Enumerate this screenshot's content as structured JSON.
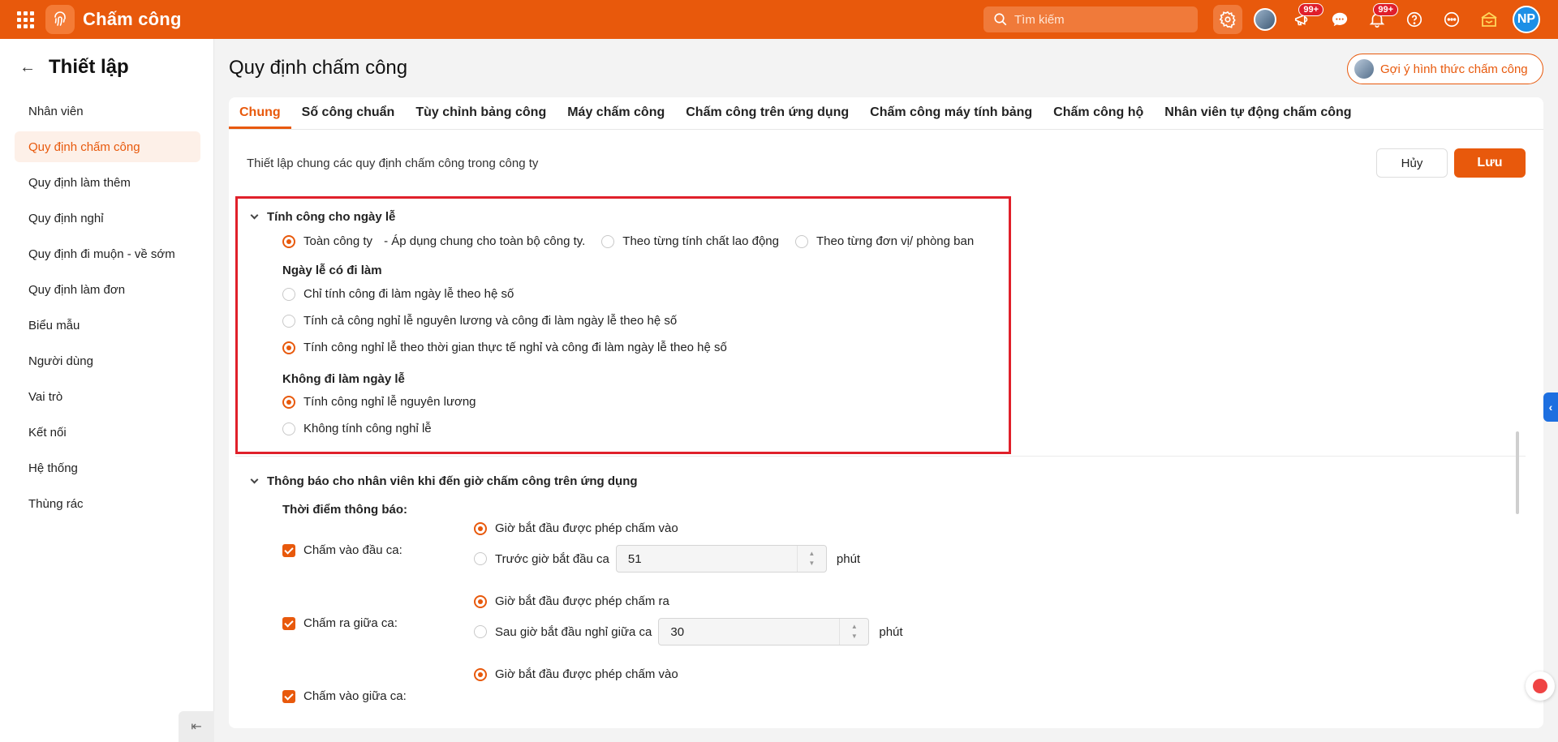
{
  "app": {
    "title": "Chấm công"
  },
  "search": {
    "placeholder": "Tìm kiếm"
  },
  "topbar": {
    "badge_1": "99+",
    "badge_2": "99+",
    "user_initials": "NP",
    "icons": [
      "apps-grid-icon",
      "fingerprint-icon",
      "settings-icon",
      "avatar",
      "megaphone-icon",
      "chat-icon",
      "bell-icon",
      "help-icon",
      "more-icon",
      "gift-icon"
    ]
  },
  "sidebar": {
    "title": "Thiết lập",
    "items": [
      {
        "label": "Nhân viên",
        "active": false
      },
      {
        "label": "Quy định chấm công",
        "active": true
      },
      {
        "label": "Quy định làm thêm",
        "active": false
      },
      {
        "label": "Quy định nghỉ",
        "active": false
      },
      {
        "label": "Quy định đi muộn - về sớm",
        "active": false
      },
      {
        "label": "Quy định làm đơn",
        "active": false
      },
      {
        "label": "Biểu mẫu",
        "active": false
      },
      {
        "label": "Người dùng",
        "active": false
      },
      {
        "label": "Vai trò",
        "active": false
      },
      {
        "label": "Kết nối",
        "active": false
      },
      {
        "label": "Hệ thống",
        "active": false
      },
      {
        "label": "Thùng rác",
        "active": false
      }
    ]
  },
  "main": {
    "page_title": "Quy định chấm công",
    "suggest_label": "Gợi ý hình thức chấm công",
    "tabs": [
      "Chung",
      "Số công chuẩn",
      "Tùy chỉnh bảng công",
      "Máy chấm công",
      "Chấm công trên ứng dụng",
      "Chấm công máy tính bảng",
      "Chấm công hộ",
      "Nhân viên tự động chấm công"
    ],
    "active_tab": "Chung",
    "description": "Thiết lập chung các quy định chấm công trong công ty",
    "cancel_label": "Hủy",
    "save_label": "Lưu"
  },
  "holiday": {
    "title": "Tính công cho ngày lễ",
    "scope_options": [
      {
        "label": "Toàn công ty",
        "note": "- Áp dụng chung cho toàn bộ công ty.",
        "selected": true
      },
      {
        "label": "Theo từng tính chất lao động",
        "selected": false
      },
      {
        "label": "Theo từng đơn vị/ phòng ban",
        "selected": false
      }
    ],
    "working_label": "Ngày lễ có đi làm",
    "working_options": [
      {
        "label": "Chỉ tính công đi làm ngày lễ theo hệ số",
        "selected": false
      },
      {
        "label": "Tính cả công nghỉ lễ nguyên lương và công đi làm ngày lễ theo hệ số",
        "selected": false
      },
      {
        "label": "Tính công nghỉ lễ theo thời gian thực tế nghỉ và công đi làm ngày lễ theo hệ số",
        "selected": true
      }
    ],
    "not_working_label": "Không đi làm ngày lễ",
    "not_working_options": [
      {
        "label": "Tính công nghỉ lễ nguyên lương",
        "selected": true
      },
      {
        "label": "Không tính công nghỉ lễ",
        "selected": false
      }
    ]
  },
  "notify": {
    "title": "Thông báo cho nhân viên khi đến giờ chấm công trên ứng dụng",
    "time_label": "Thời điểm thông báo:",
    "unit": "phút",
    "groups": [
      {
        "label": "Chấm vào đầu ca:",
        "checked": true,
        "option_1": "Giờ bắt đầu được phép chấm vào",
        "option_2": "Trước giờ bắt đầu ca",
        "value": "51"
      },
      {
        "label": "Chấm ra giữa ca:",
        "checked": true,
        "option_1": "Giờ bắt đầu được phép chấm ra",
        "option_2": "Sau giờ bắt đầu nghỉ giữa ca",
        "value": "30"
      },
      {
        "label": "Chấm vào giữa ca:",
        "checked": true,
        "option_1": "Giờ bắt đầu được phép chấm vào"
      }
    ]
  },
  "colors": {
    "brand": "#e8590c",
    "highlight": "#e0202a"
  }
}
